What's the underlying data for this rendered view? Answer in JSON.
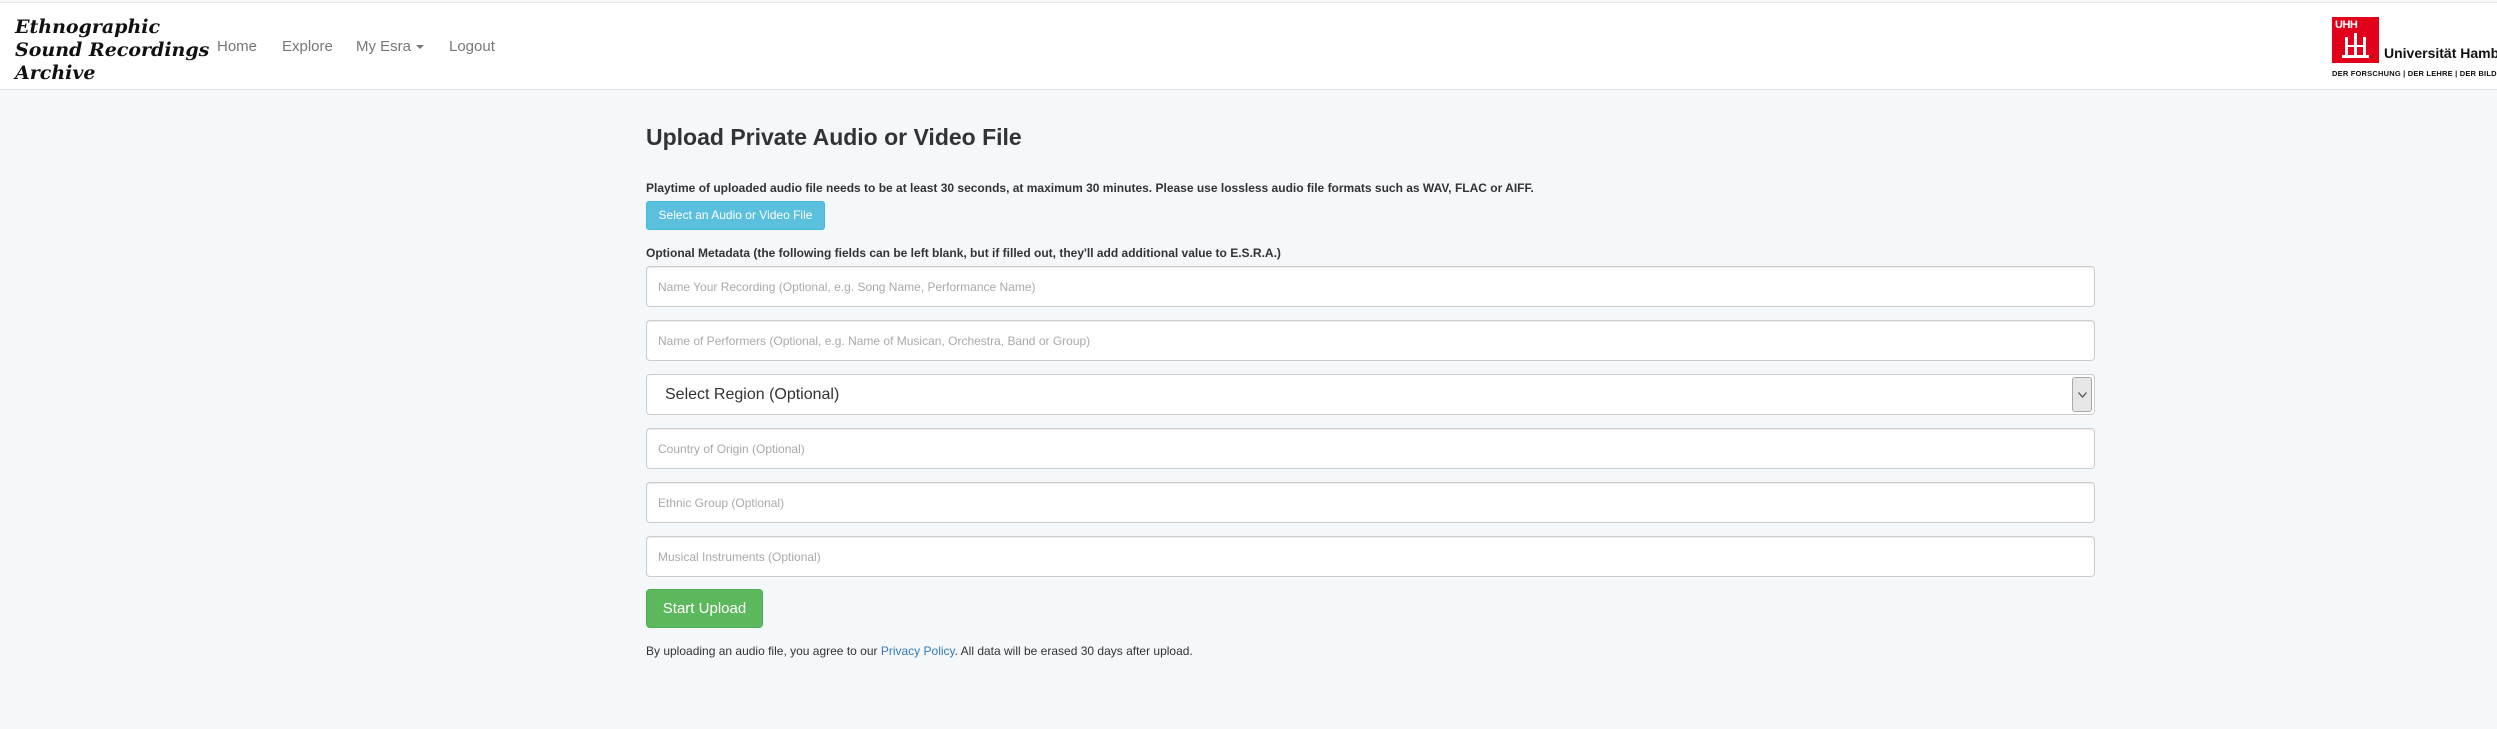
{
  "header": {
    "brand_lines": [
      "Ethnographic",
      "Sound Recordings",
      "Archive"
    ],
    "nav": {
      "home": "Home",
      "explore": "Explore",
      "my_esra": "My Esra",
      "logout": "Logout"
    },
    "university_logo": {
      "mark_text": "UHH",
      "name": "Universität Hamburg",
      "tagline": "DER FORSCHUNG | DER LEHRE | DER BILDUNG"
    }
  },
  "main": {
    "title": "Upload Private Audio or Video File",
    "playtime_note": "Playtime of uploaded audio file needs to be at least 30 seconds, at maximum 30 minutes. Please use lossless audio file formats such as WAV, FLAC or AIFF.",
    "select_file_button": "Select an Audio or Video File",
    "metadata_label": "Optional Metadata (the following fields can be left blank, but if filled out, they'll add additional value to E.S.R.A.)",
    "fields": {
      "recording_name_placeholder": "Name Your Recording (Optional, e.g. Song Name, Performance Name)",
      "performers_placeholder": "Name of Performers (Optional, e.g. Name of Musican, Orchestra, Band or Group)",
      "region_selected": "Select Region (Optional)",
      "country_placeholder": "Country of Origin (Optional)",
      "ethnic_group_placeholder": "Ethnic Group (Optional)",
      "instruments_placeholder": "Musical Instruments (Optional)"
    },
    "start_upload_button": "Start Upload",
    "agreement": {
      "prefix": "By uploading an audio file, you agree to our ",
      "link": "Privacy Policy",
      "suffix": ". All data will be erased 30 days after upload."
    }
  },
  "colors": {
    "brand_red": "#e2001a",
    "info_button": "#5bc0de",
    "success_button": "#5cb85c",
    "link": "#337ab7",
    "page_background": "#f4f8fa"
  },
  "icons": {
    "dropdown_caret": "caret-down-icon",
    "select_arrow": "chevron-down-icon"
  }
}
